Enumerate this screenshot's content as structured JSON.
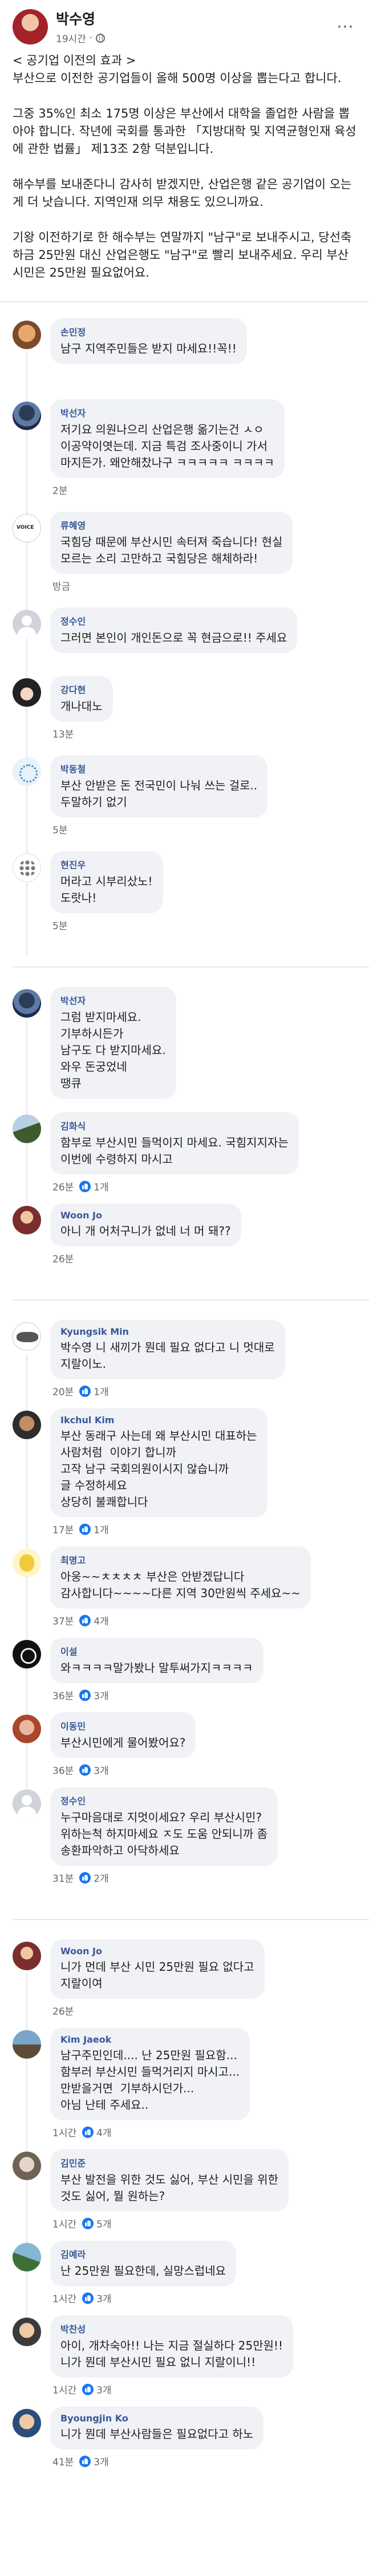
{
  "post": {
    "author": "박수영",
    "time": "19시간",
    "paragraphs": [
      "< 공기업 이전의 효과 >\n부산으로 이전한 공기업들이 올해 500명 이상을 뽑는다고 합니다.",
      "그중 35%인 최소 175명 이상은 부산에서 대학을 졸업한 사람을 뽑아야 합니다. 작년에 국회를 통과한 「지방대학 및 지역균형인재 육성에 관한 법률」 제13조 2항 덕분입니다.",
      "해수부를 보내준다니 감사히 받겠지만, 산업은행 같은 공기업이 오는 게 더 낫습니다. 지역인재 의무 채용도 있으니까요.",
      "기왕 이전하기로 한 해수부는 연말까지 \"남구\"로 보내주시고, 당선축하금 25만원 대신 산업은행도 \"남구\"로 빨리 보내주세요. 우리 부산시민은 25만원 필요없어요."
    ]
  },
  "comments": [
    {
      "name": "손민정",
      "text": "남구 지역주민들은 받지 마세요!!꼭!!",
      "time": "",
      "likes": ""
    },
    {
      "name": "박선자",
      "text": "저기요 의원나으리 산업은행 옮기는건 ㅅㅇ\n이공약이엿는데. 지금 특검 조사중이니 가서\n마지든가. 왜안해찼나구 ㅋㅋㅋㅋㅋ ㅋㅋㅋㅋ",
      "time": "2분",
      "likes": ""
    },
    {
      "name": "류혜영",
      "text": "국힘당 때문에 부산시민 속터져 죽습니다! 현실\n모르는 소리 고만하고 국힘당은 해체하라!",
      "time": "방금",
      "likes": ""
    },
    {
      "name": "정수인",
      "text": "그러면 본인이 개인돈으로 꼭 현금으로!! 주세요",
      "time": "",
      "likes": ""
    },
    {
      "name": "강다현",
      "text": "개나대노",
      "time": "13분",
      "likes": ""
    },
    {
      "name": "박동철",
      "text": "부산 안받은 돈 전국민이 나눠 쓰는 걸로..\n두말하기 없기",
      "time": "5분",
      "likes": ""
    },
    {
      "name": "현진우",
      "text": "머라고 시부리샀노!\n도랏나!",
      "time": "5분",
      "likes": ""
    },
    {
      "name": "박선자",
      "text": "그럼 받지마세요.\n기부하시든가\n남구도 다 받지마세요.\n와우 돈궁었네\n땡큐",
      "time": "",
      "likes": ""
    },
    {
      "name": "김화식",
      "text": "함부로 부산시민 들먹이지 마세요. 국힘지지자는\n이번에 수령하지 마시고",
      "time": "26분",
      "likes": "1개"
    },
    {
      "name": "Woon Jo",
      "text": "아니 개 어처구니가 없네 너 머 돼??",
      "time": "26분",
      "likes": ""
    },
    {
      "name": "Kyungsik Min",
      "text": "박수영 니 새끼가 뭔데 필요 없다고 니 멋대로\n지랄이노.",
      "time": "20분",
      "likes": "1개"
    },
    {
      "name": "Ikchul Kim",
      "text": "부산 동래구 사는데 왜 부산시민 대표하는\n사람처럼  이야기 합니까\n고작 남구 국회의원이시지 않습니까\n글 수정하세요\n상당히 불쾌합니다",
      "time": "17분",
      "likes": "1개"
    },
    {
      "name": "최명고",
      "text": "아웅~~ㅊㅊㅊㅊ 부산은 안받겠답니다\n감사합니다~~~~다른 지역 30만원씩 주세요~~",
      "time": "37분",
      "likes": "4개"
    },
    {
      "name": "이설",
      "text": "와ㅋㅋㅋㅋ말가봤나 말투써가지ㅋㅋㅋㅋ",
      "time": "36분",
      "likes": "3개"
    },
    {
      "name": "이동민",
      "text": "부산시민에게 물어봤어요?",
      "time": "36분",
      "likes": "3개"
    },
    {
      "name": "정수인",
      "text": "누구마음대로 지멋이세요? 우리 부산시민?\n위하는척 하지마세요 ㅈ도 도움 안되니까 좀\n송환파악하고 아닥하세요",
      "time": "31분",
      "likes": "2개"
    },
    {
      "name": "Woon Jo",
      "text": "니가 먼데 부산 시민 25만원 필요 없다고\n지랄이여",
      "time": "26분",
      "likes": ""
    },
    {
      "name": "Kim Jaeok",
      "text": "남구주민인데.... 난 25만원 필요함...\n함부러 부산시민 들먹거리지 마시고...\n만받을거면  기부하시던가...\n아님 난테 주세요..",
      "time": "1시간",
      "likes": "4개"
    },
    {
      "name": "김민준",
      "text": "부산 발전을 위한 것도 싫어, 부산 시민을 위한\n것도 싫어, 뭘 원하는?",
      "time": "1시간",
      "likes": "5개"
    },
    {
      "name": "김예라",
      "text": "난 25만원 필요한데, 실망스럽네요",
      "time": "1시간",
      "likes": "3개"
    },
    {
      "name": "박찬성",
      "text": "아이, 개차숙아!! 나는 지금 절실하다 25만원!!\n니가 뭔데 부산시민 필요 없니 지랄이니!!",
      "time": "1시간",
      "likes": "3개"
    },
    {
      "name": "Byoungjin Ko",
      "text": "니가 뭔데 부산사람들은 필요없다고 하노",
      "time": "41분",
      "likes": "3개"
    }
  ]
}
